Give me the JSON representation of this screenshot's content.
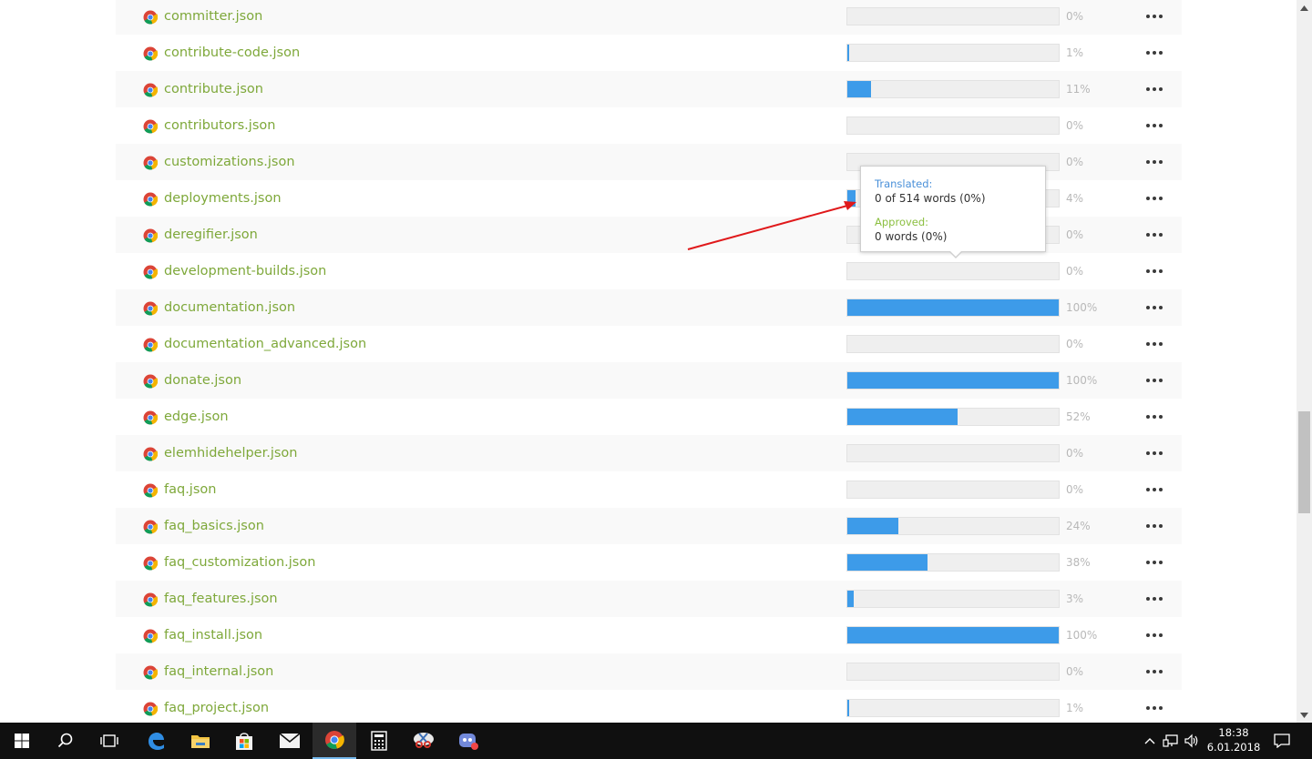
{
  "files": [
    {
      "name": "committer.json",
      "progress": 0,
      "percent_label": "0%"
    },
    {
      "name": "contribute-code.json",
      "progress": 1,
      "percent_label": "1%"
    },
    {
      "name": "contribute.json",
      "progress": 11,
      "percent_label": "11%"
    },
    {
      "name": "contributors.json",
      "progress": 0,
      "percent_label": "0%"
    },
    {
      "name": "customizations.json",
      "progress": 0,
      "percent_label": "0%"
    },
    {
      "name": "deployments.json",
      "progress": 4,
      "percent_label": "4%"
    },
    {
      "name": "deregifier.json",
      "progress": 0,
      "percent_label": "0%"
    },
    {
      "name": "development-builds.json",
      "progress": 0,
      "percent_label": "0%"
    },
    {
      "name": "documentation.json",
      "progress": 100,
      "percent_label": "100%"
    },
    {
      "name": "documentation_advanced.json",
      "progress": 0,
      "percent_label": "0%"
    },
    {
      "name": "donate.json",
      "progress": 100,
      "percent_label": "100%"
    },
    {
      "name": "edge.json",
      "progress": 52,
      "percent_label": "52%"
    },
    {
      "name": "elemhidehelper.json",
      "progress": 0,
      "percent_label": "0%"
    },
    {
      "name": "faq.json",
      "progress": 0,
      "percent_label": "0%"
    },
    {
      "name": "faq_basics.json",
      "progress": 24,
      "percent_label": "24%"
    },
    {
      "name": "faq_customization.json",
      "progress": 38,
      "percent_label": "38%"
    },
    {
      "name": "faq_features.json",
      "progress": 3,
      "percent_label": "3%"
    },
    {
      "name": "faq_install.json",
      "progress": 100,
      "percent_label": "100%"
    },
    {
      "name": "faq_internal.json",
      "progress": 0,
      "percent_label": "0%"
    },
    {
      "name": "faq_project.json",
      "progress": 1,
      "percent_label": "1%"
    }
  ],
  "tooltip": {
    "translated_label": "Translated:",
    "translated_value": "0 of 514 words (0%)",
    "approved_label": "Approved:",
    "approved_value": "0 words (0%)"
  },
  "colors": {
    "file_link": "#7ea83a",
    "progress_fill": "#3d9be9",
    "translated_label": "#4a90d9",
    "approved_label": "#8bbf40",
    "annotation_arrow": "#e0191b"
  },
  "taskbar": {
    "time": "18:38",
    "date": "6.01.2018",
    "apps": [
      "windows-start",
      "search",
      "task-view",
      "edge",
      "file-explorer",
      "store",
      "mail",
      "chrome",
      "calculator",
      "snipping-tool",
      "discord"
    ]
  }
}
